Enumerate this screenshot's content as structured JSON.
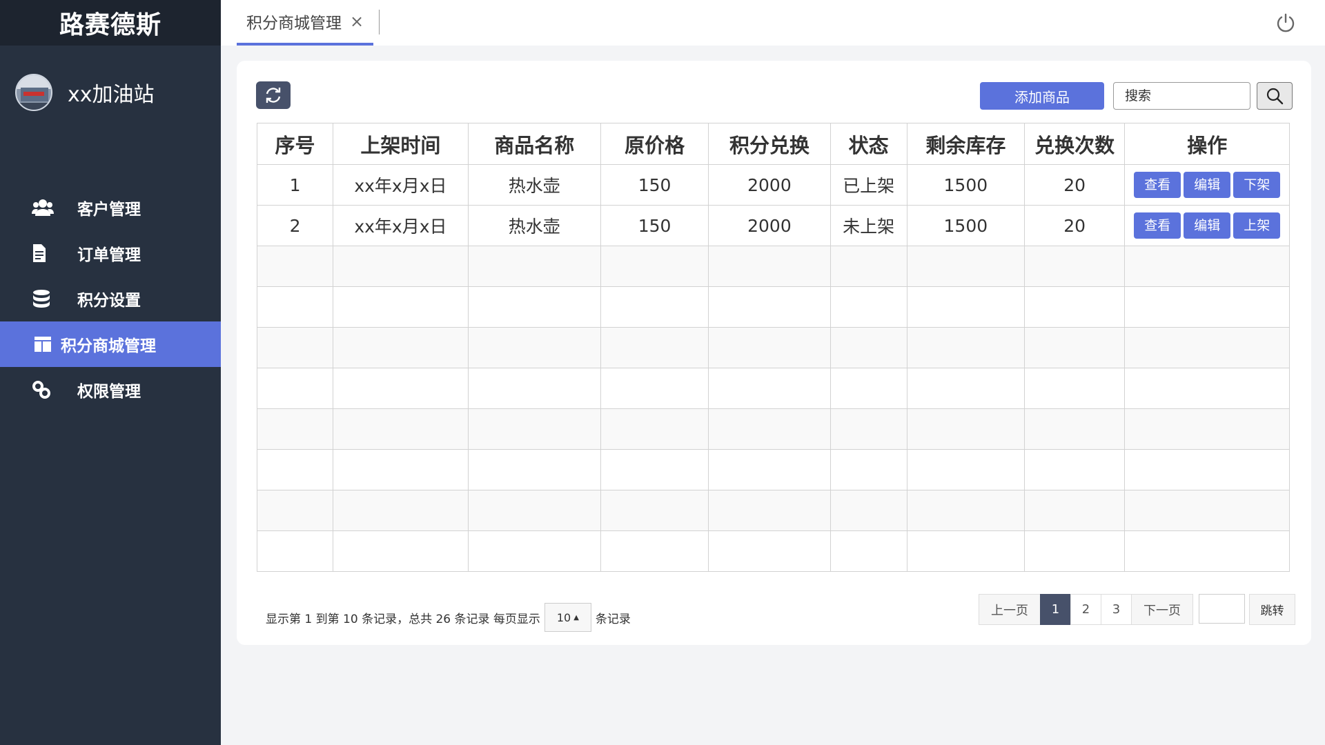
{
  "sidebar": {
    "brand": "路赛德斯",
    "station": "xx加油站",
    "items": [
      {
        "label": "客户管理",
        "icon": "users-icon"
      },
      {
        "label": "订单管理",
        "icon": "document-icon"
      },
      {
        "label": "积分设置",
        "icon": "database-icon"
      },
      {
        "label": "积分商城管理",
        "icon": "table-icon",
        "active": true
      },
      {
        "label": "权限管理",
        "icon": "link-icon"
      }
    ]
  },
  "topbar": {
    "tab_label": "积分商城管理",
    "close_glyph": "×"
  },
  "toolbar": {
    "add_label": "添加商品",
    "search_placeholder": "搜索"
  },
  "table": {
    "columns": [
      "序号",
      "上架时间",
      "商品名称",
      "原价格",
      "积分兑换",
      "状态",
      "剩余库存",
      "兑换次数",
      "操作"
    ],
    "rows": [
      {
        "index": "1",
        "time": "xx年x月x日",
        "name": "热水壶",
        "price": "150",
        "points": "2000",
        "status": "已上架",
        "stock": "1500",
        "count": "20",
        "actions": [
          "查看",
          "编辑",
          "下架"
        ]
      },
      {
        "index": "2",
        "time": "xx年x月x日",
        "name": "热水壶",
        "price": "150",
        "points": "2000",
        "status": "未上架",
        "stock": "1500",
        "count": "20",
        "actions": [
          "查看",
          "编辑",
          "上架"
        ]
      }
    ]
  },
  "footer": {
    "info": "显示第 1 到第 10 条记录，总共 26 条记录 每页显示",
    "page_size": "10",
    "suffix": "条记录",
    "prev": "上一页",
    "pages": [
      "1",
      "2",
      "3"
    ],
    "current_page": "1",
    "next": "下一页",
    "jump": "跳转"
  },
  "colors": {
    "accent": "#5b72dc",
    "sidebar_bg": "#273140",
    "brand_bg": "#1d242f",
    "dark_button": "#47516a"
  }
}
